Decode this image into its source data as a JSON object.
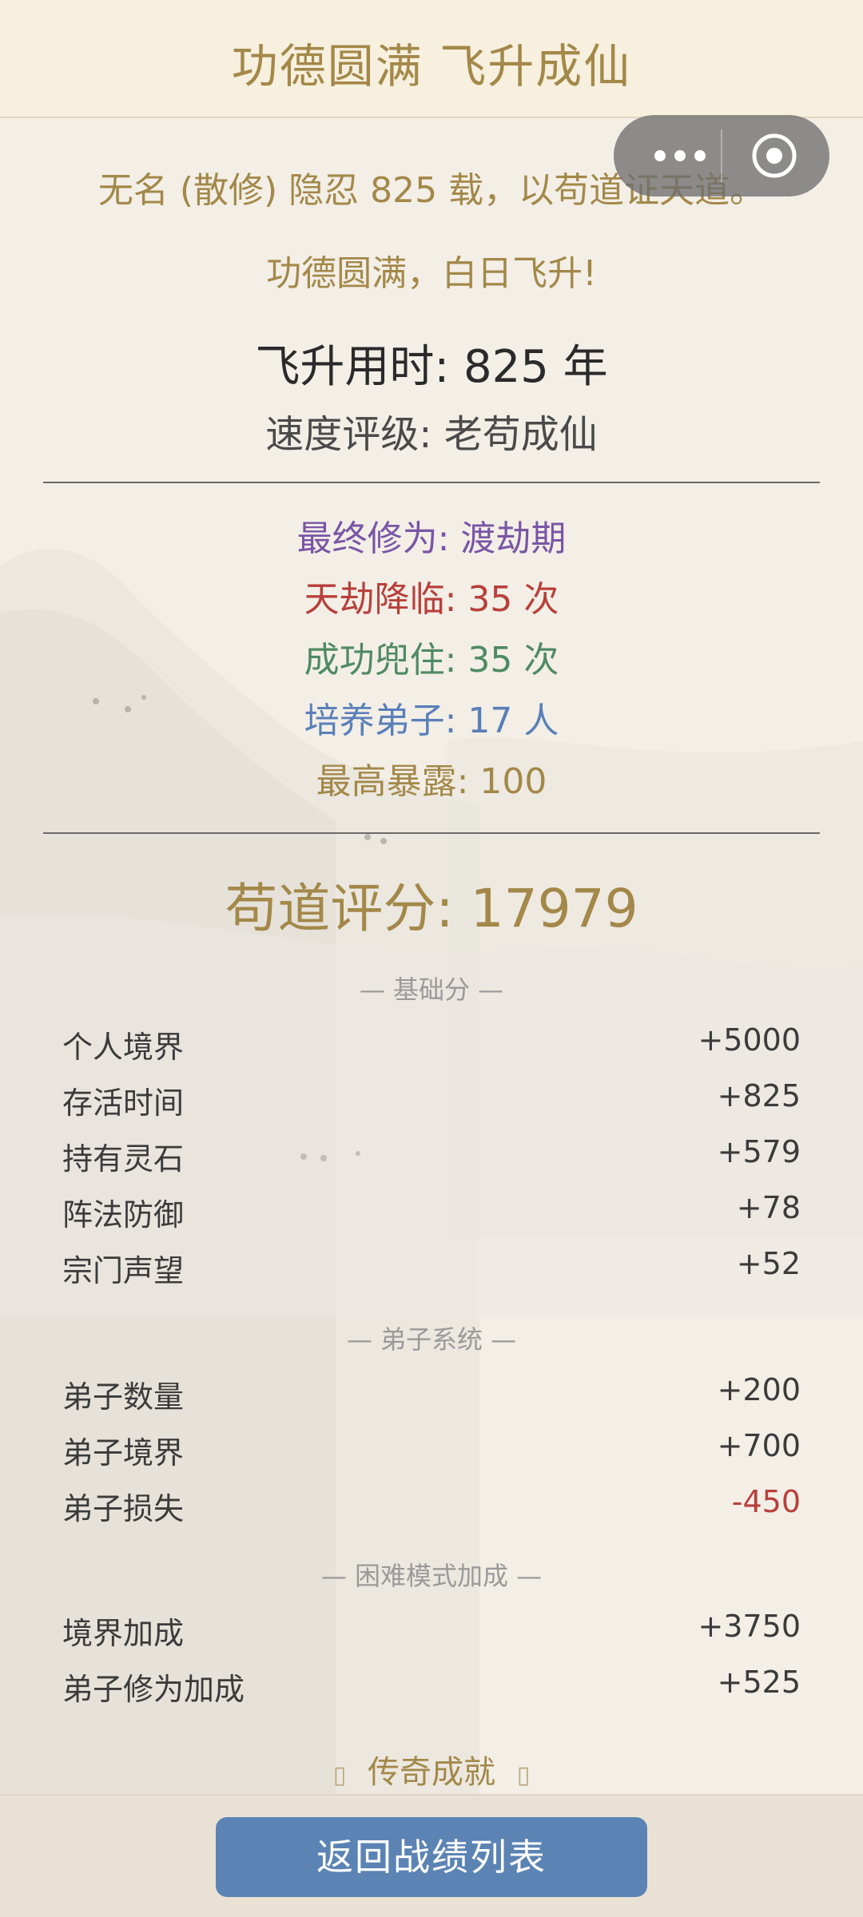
{
  "header": {
    "title": "功德圆满 飞升成仙"
  },
  "summary": {
    "line1": "无名 (散修) 隐忍 825 载，以苟道证天道。",
    "line2": "功德圆满，白日飞升!",
    "time_label": "飞升用时: 825 年",
    "rating_label": "速度评级: 老苟成仙"
  },
  "stats": {
    "cultivation": "最终修为: 渡劫期",
    "tribulations": "天劫降临: 35 次",
    "survived": "成功兜住: 35 次",
    "disciples": "培养弟子: 17 人",
    "exposure": "最高暴露: 100"
  },
  "score": {
    "label": "苟道评分: 17979"
  },
  "sections": {
    "base": {
      "title": "— 基础分 —",
      "rows": [
        {
          "label": "个人境界",
          "value": "+5000"
        },
        {
          "label": "存活时间",
          "value": "+825"
        },
        {
          "label": "持有灵石",
          "value": "+579"
        },
        {
          "label": "阵法防御",
          "value": "+78"
        },
        {
          "label": "宗门声望",
          "value": "+52"
        }
      ]
    },
    "disciple": {
      "title": "— 弟子系统 —",
      "rows": [
        {
          "label": "弟子数量",
          "value": "+200"
        },
        {
          "label": "弟子境界",
          "value": "+700"
        },
        {
          "label": "弟子损失",
          "value": "-450"
        }
      ]
    },
    "hard": {
      "title": "— 困难模式加成 —",
      "rows": [
        {
          "label": "境界加成",
          "value": "+3750"
        },
        {
          "label": "弟子修为加成",
          "value": "+525"
        }
      ]
    }
  },
  "legend": {
    "label": "传奇成就",
    "glyph": "▯"
  },
  "footer": {
    "button_label": "返回战绩列表"
  },
  "colors": {
    "gold": "#a38849",
    "purple": "#7a55a6",
    "red": "#b8403a",
    "green": "#4f8a63",
    "blue": "#5a7fb8",
    "button": "#5b83b4"
  },
  "icons": {
    "menu": "more-dots-icon",
    "close": "target-circle-icon"
  }
}
